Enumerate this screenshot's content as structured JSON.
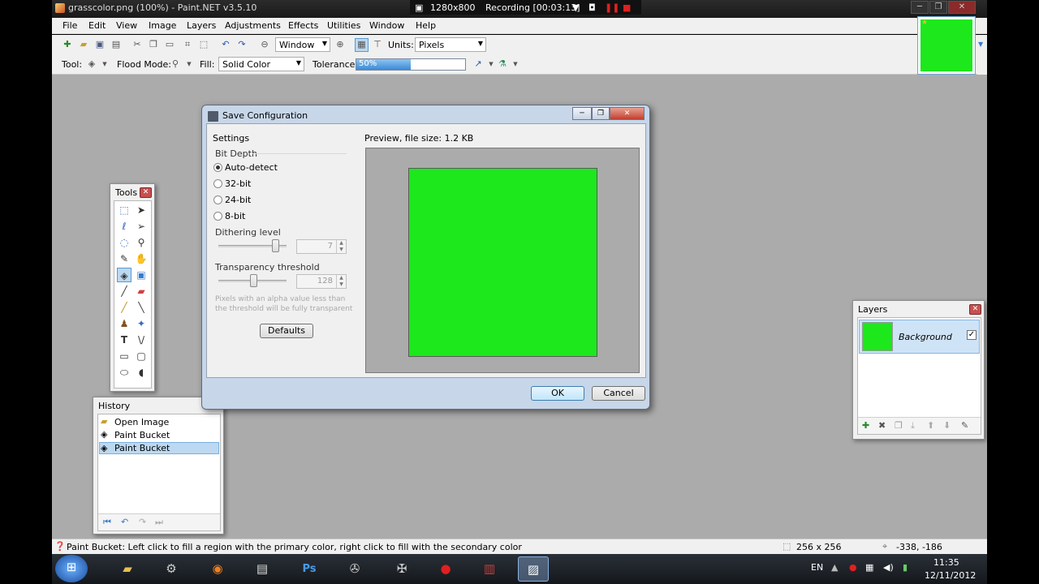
{
  "window": {
    "title": "grasscolor.png (100%) - Paint.NET v3.5.10",
    "recording_resolution": "1280x800",
    "recording_status": "Recording [00:03:13]"
  },
  "menu": [
    "File",
    "Edit",
    "View",
    "Image",
    "Layers",
    "Adjustments",
    "Effects",
    "Utilities",
    "Window",
    "Help"
  ],
  "toolbar": {
    "zoom_mode": "Window",
    "units_label": "Units:",
    "units_value": "Pixels",
    "tool_label": "Tool:",
    "flood_mode_label": "Flood Mode:",
    "fill_label": "Fill:",
    "fill_value": "Solid Color",
    "tolerance_label": "Tolerance:",
    "tolerance_value": "50%",
    "tolerance_fraction": 0.5
  },
  "tools_panel": {
    "title": "Tools"
  },
  "history_panel": {
    "title": "History",
    "items": [
      "Open Image",
      "Paint Bucket",
      "Paint Bucket"
    ],
    "selected_index": 2
  },
  "layers_panel": {
    "title": "Layers",
    "layers": [
      {
        "name": "Background",
        "visible": true
      }
    ]
  },
  "dialog": {
    "title": "Save Configuration",
    "settings_label": "Settings",
    "bit_depth_label": "Bit Depth",
    "options": [
      "Auto-detect",
      "32-bit",
      "24-bit",
      "8-bit"
    ],
    "selected_option": "Auto-detect",
    "dithering_label": "Dithering level",
    "dithering_value": "7",
    "transparency_label": "Transparency threshold",
    "transparency_value": "128",
    "hint_line1": "Pixels with an alpha value less than",
    "hint_line2": "the threshold will be fully transparent",
    "defaults_button": "Defaults",
    "preview_label": "Preview, file size: 1.2 KB",
    "ok_button": "OK",
    "cancel_button": "Cancel"
  },
  "statusbar": {
    "hint": "Paint Bucket: Left click to fill a region with the primary color, right click to fill with the secondary color",
    "image_size": "256 x 256",
    "cursor_pos": "-338, -186"
  },
  "taskbar": {
    "language": "EN",
    "time": "11:35",
    "date": "12/11/2012"
  },
  "colors": {
    "image_fill": "#1ce81c",
    "workspace": "#ababab",
    "selection": "#bcd9f1"
  }
}
